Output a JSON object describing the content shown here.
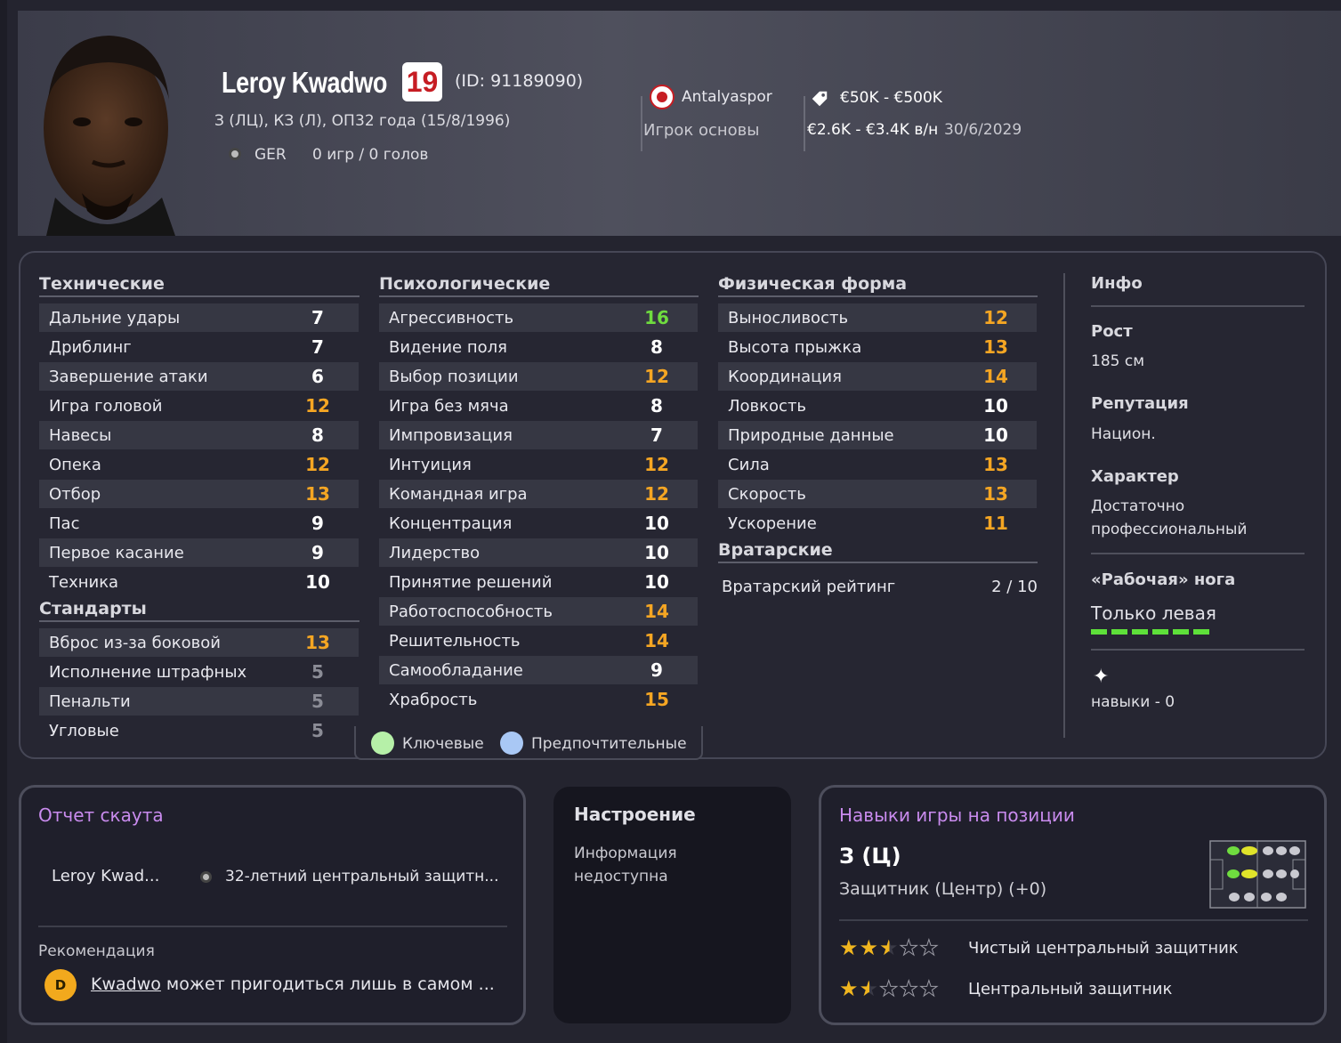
{
  "player": {
    "name": "Leroy Kwadwo",
    "number": "19",
    "id": "(ID: 91189090)",
    "positions": "З (ЛЦ), КЗ (Л), ОП",
    "age_birth": "32 года (15/8/1996)",
    "nation": "GER",
    "games": "0 игр / 0 голов"
  },
  "club": {
    "name": "Antalyaspor",
    "role": "Игрок основы"
  },
  "contract": {
    "value": "€50K - €500K",
    "wage": "€2.6K - €3.4K  в/н",
    "expires": "30/6/2029"
  },
  "technical": {
    "title": "Технические",
    "rows": [
      {
        "label": "Дальние удары",
        "value": "7"
      },
      {
        "label": "Дриблинг",
        "value": "7"
      },
      {
        "label": "Завершение атаки",
        "value": "6"
      },
      {
        "label": "Игра головой",
        "value": "12"
      },
      {
        "label": "Навесы",
        "value": "8"
      },
      {
        "label": "Опека",
        "value": "12"
      },
      {
        "label": "Отбор",
        "value": "13"
      },
      {
        "label": "Пас",
        "value": "9"
      },
      {
        "label": "Первое касание",
        "value": "9"
      },
      {
        "label": "Техника",
        "value": "10"
      }
    ]
  },
  "set_pieces": {
    "title": "Стандарты",
    "rows": [
      {
        "label": "Вброс из-за боковой",
        "value": "13"
      },
      {
        "label": "Исполнение штрафных",
        "value": "5"
      },
      {
        "label": "Пенальти",
        "value": "5"
      },
      {
        "label": "Угловые",
        "value": "5"
      }
    ]
  },
  "mental": {
    "title": "Психологические",
    "rows": [
      {
        "label": "Агрессивность",
        "value": "16"
      },
      {
        "label": "Видение поля",
        "value": "8"
      },
      {
        "label": "Выбор позиции",
        "value": "12"
      },
      {
        "label": "Игра без мяча",
        "value": "8"
      },
      {
        "label": "Импровизация",
        "value": "7"
      },
      {
        "label": "Интуиция",
        "value": "12"
      },
      {
        "label": "Командная игра",
        "value": "12"
      },
      {
        "label": "Концентрация",
        "value": "10"
      },
      {
        "label": "Лидерство",
        "value": "10"
      },
      {
        "label": "Принятие решений",
        "value": "10"
      },
      {
        "label": "Работоспособность",
        "value": "14"
      },
      {
        "label": "Решительность",
        "value": "14"
      },
      {
        "label": "Самообладание",
        "value": "9"
      },
      {
        "label": "Храбрость",
        "value": "15"
      }
    ]
  },
  "physical": {
    "title": "Физическая форма",
    "rows": [
      {
        "label": "Выносливость",
        "value": "12"
      },
      {
        "label": "Высота прыжка",
        "value": "13"
      },
      {
        "label": "Координация",
        "value": "14"
      },
      {
        "label": "Ловкость",
        "value": "10"
      },
      {
        "label": "Природные данные",
        "value": "10"
      },
      {
        "label": "Сила",
        "value": "13"
      },
      {
        "label": "Скорость",
        "value": "13"
      },
      {
        "label": "Ускорение",
        "value": "11"
      }
    ]
  },
  "goalkeeping": {
    "title": "Вратарские",
    "rating_label": "Вратарский рейтинг",
    "rating_value": "2 / 10"
  },
  "legend": {
    "key": "Ключевые",
    "preferred": "Предпочтительные",
    "key_color": "#b6f0a8",
    "preferred_color": "#a9c8f5"
  },
  "info": {
    "title": "Инфо",
    "height_label": "Рост",
    "height_value": "185 см",
    "reputation_label": "Репутация",
    "reputation_value": "Национ.",
    "character_label": "Характер",
    "character_value_1": "Достаточно",
    "character_value_2": "профессиональный",
    "foot_label": "«Рабочая» нога",
    "foot_value": "Только левая",
    "skills": "навыки - 0"
  },
  "scout": {
    "title": "Отчет скаута",
    "name": "Leroy Kwad...",
    "summary": "32-летний центральный защитн...",
    "recommendation_label": "Рекомендация",
    "grade": "D",
    "rec_name": "Kwadwo",
    "rec_text": " может пригодиться лишь в самом ..."
  },
  "mood": {
    "title": "Настроение",
    "line1": "Информация",
    "line2": "недоступна"
  },
  "position_skills": {
    "title": "Навыки игры на позиции",
    "position": "З (Ц)",
    "description": "Защитник (Центр) (+0)",
    "roles": [
      {
        "name": "Чистый центральный защитник",
        "stars": 2.5
      },
      {
        "name": "Центральный защитник",
        "stars": 1.5
      }
    ]
  },
  "colors": {
    "orange": "#f5a623",
    "green": "#6fdc3f",
    "purple": "#c98bee"
  }
}
